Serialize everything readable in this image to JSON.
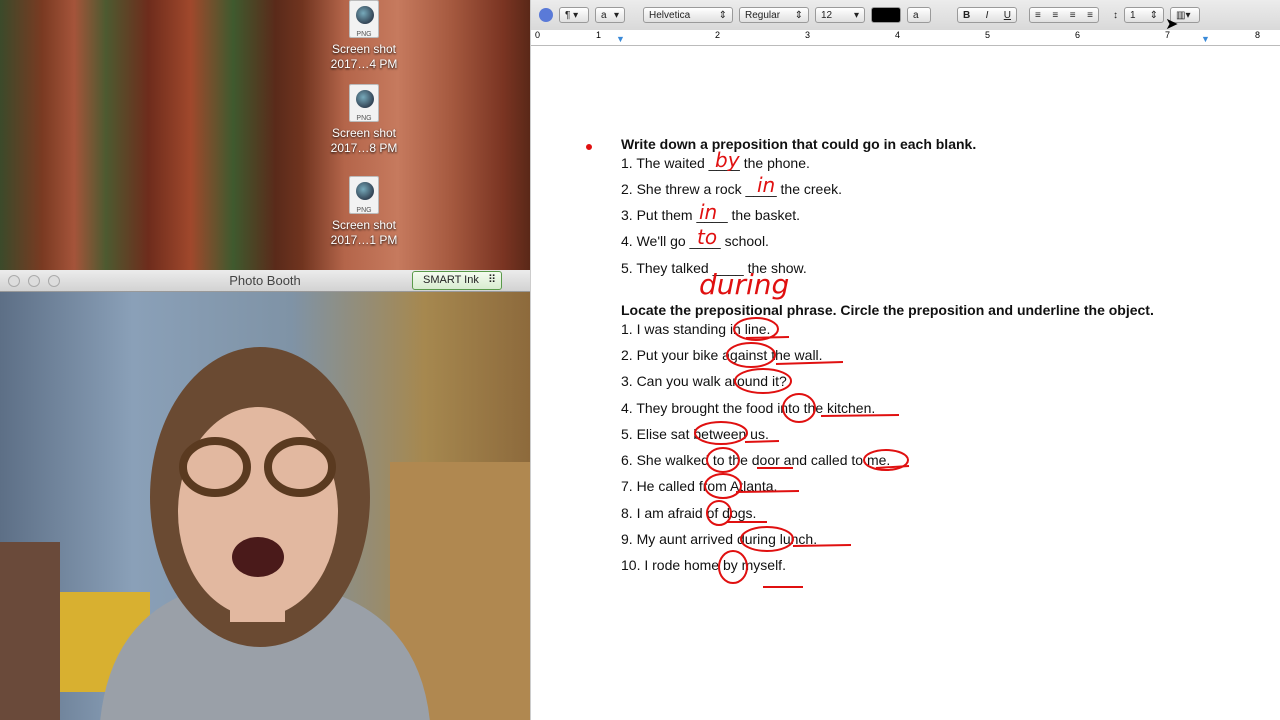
{
  "desktop": {
    "icons": [
      {
        "type": "PNG",
        "label1": "Screen shot",
        "label2": "2017…4 PM"
      },
      {
        "type": "PNG",
        "label1": "Screen shot",
        "label2": "2017…8 PM"
      },
      {
        "type": "PNG",
        "label1": "Screen shot",
        "label2": "2017…1 PM"
      }
    ]
  },
  "photo_booth": {
    "title": "Photo Booth",
    "smart_ink": "SMART Ink"
  },
  "toolbar": {
    "font": "Helvetica",
    "style": "Regular",
    "size": "12",
    "text_color": "#000000",
    "bold": "B",
    "italic": "I",
    "underline": "U",
    "line_spacing": "1",
    "char_a": "a"
  },
  "ruler": [
    "0",
    "1",
    "2",
    "3",
    "4",
    "5",
    "6",
    "7",
    "8"
  ],
  "document": {
    "heading1": "Write down a preposition that could go in each blank.",
    "part1": [
      "1. The waited ____ the phone.",
      "2. She threw a rock ____ the creek.",
      "3. Put them ____ the basket.",
      "4. We'll go ____ school.",
      "5. They talked ____ the show."
    ],
    "heading2": "Locate the prepositional phrase. Circle the preposition and underline the object.",
    "part2": [
      "1. I was standing in line.",
      "2. Put your bike against the wall.",
      "3. Can you walk around it?",
      "4. They brought the food into the kitchen.",
      "5. Elise sat between us.",
      "6. She walked to the door and called to me.",
      "7. He called from Atlanta.",
      "8. I am afraid of dogs.",
      "9. My aunt arrived during lunch.",
      "10. I rode home by myself."
    ],
    "ink": [
      "by",
      "in",
      "in",
      "to",
      "during"
    ],
    "ink_color": "#e01010"
  }
}
